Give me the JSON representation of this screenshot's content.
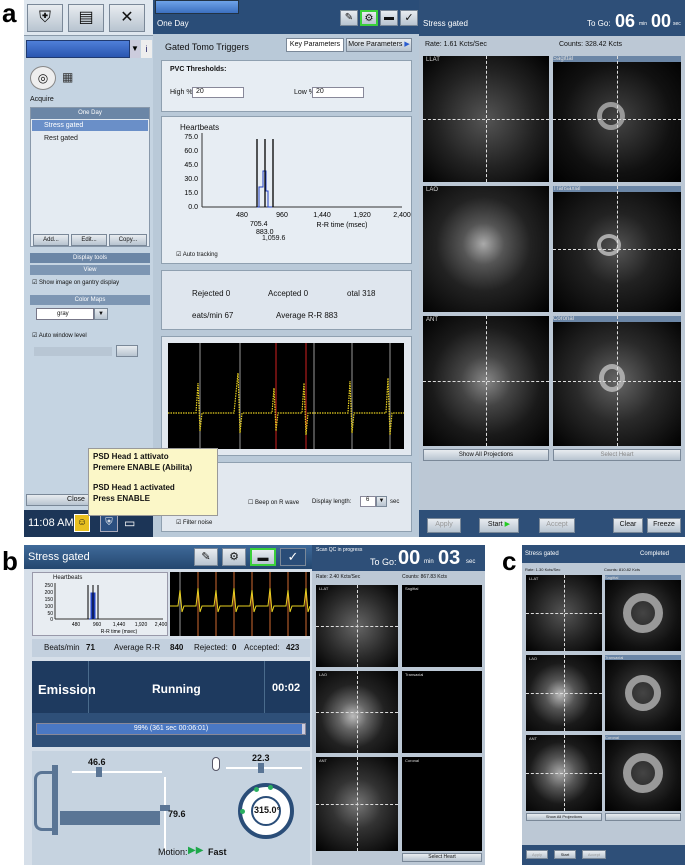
{
  "panels": {
    "a": "a",
    "b": "b",
    "c": "c"
  },
  "a": {
    "toolbar_mode_label": "One Day",
    "side": {
      "acquire": "Acquire",
      "protocol_title": "One Day",
      "protocol_items": [
        "Stress gated",
        "Rest gated"
      ],
      "btn_add": "Add...",
      "btn_edit": "Edit...",
      "btn_copy": "Copy...",
      "display_tools": "Display tools",
      "view": "View",
      "show_image_label": "Show image on gantry display",
      "color_maps": "Color Maps",
      "color_map_value": "gray",
      "auto_window": "Auto window level",
      "close": "Close",
      "clock": "11:08 AM"
    },
    "middle": {
      "title": "Gated Tomo Triggers",
      "tab_key": "Key Parameters",
      "tab_more": "More Parameters",
      "pvc_title": "PVC Thresholds:",
      "high_label": "High %",
      "high_value": "20",
      "low_label": "Low %",
      "low_value": "20",
      "hb_title": "Heartbeats",
      "y_ticks": [
        "75.0",
        "60.0",
        "45.0",
        "30.0",
        "15.0",
        "0.0"
      ],
      "x_ticks": [
        "480",
        "960",
        "1,440",
        "1,920",
        "2,400"
      ],
      "x_label": "R-R time (msec)",
      "markers": [
        "705.4",
        "883.0",
        "1,059.6"
      ],
      "auto_tracking": "Auto tracking",
      "rejected": "Rejected 0",
      "accepted": "Accepted 0",
      "total": "otal 318",
      "beats_min": "eats/min 67",
      "average_rr": "Average R-R 883",
      "beep": "Beep on R wave",
      "display_length": "Display length:",
      "display_length_value": "6",
      "sec": "sec",
      "filter": "Filter noise"
    },
    "tooltip": {
      "line1": "PSD Head 1 attivato",
      "line2": "Premere ENABLE (Abilita)",
      "line3": "PSD Head 1 activated",
      "line4": "Press ENABLE"
    },
    "right": {
      "title": "Stress gated",
      "to_go": "To Go:",
      "min_value": "06",
      "min_unit": "min",
      "sec_value": "00",
      "sec_unit": "sec",
      "rate": "Rate: 1.61 Kcts/Sec",
      "counts": "Counts: 328.42 Kcts",
      "scan_labels": [
        "LLAT",
        "Sagittal",
        "LAO",
        "Transaxial",
        "ANT",
        "Coronal"
      ],
      "show_all": "Show All Projections",
      "select_heart": "Select Heart",
      "apply": "Apply",
      "start": "Start",
      "accept": "Accept",
      "clear": "Clear",
      "freeze": "Freeze"
    }
  },
  "b": {
    "title": "Stress gated",
    "to_go": "To Go:",
    "min_value": "00",
    "min_unit": "min",
    "sec_value": "03",
    "sec_unit": "sec",
    "scan_qc": "Scan QC in progress",
    "hb_title": "Heartbeats",
    "y_ticks": [
      "250",
      "200",
      "150",
      "100",
      "50",
      "0"
    ],
    "x_ticks": [
      "480",
      "960",
      "1,440",
      "1,920",
      "2,400"
    ],
    "x_label": "R-R time (msec)",
    "beats_min_label": "Beats/min",
    "beats_min": "71",
    "avg_label": "Average R-R",
    "avg_value": "840",
    "rej_label": "Rejected:",
    "rej_value": "0",
    "acc_label": "Accepted:",
    "acc_value": "423",
    "emission": "Emission",
    "running": "Running",
    "elapsed": "00:02",
    "progress_text": "99% (361 sec  00:06:01)",
    "progress": 0.99,
    "gantry_top": "46.6",
    "gantry_side": "79.6",
    "detector_top": "22.3",
    "angle": "315.0°",
    "motion_label": "Motion:",
    "motion_value": "Fast",
    "rate": "Rate: 2.40 Kcts/Sec",
    "counts": "Counts: 867.83 Kcts",
    "scan_labels": [
      "LLAT",
      "Sagittal",
      "LAO",
      "Transaxial",
      "ANT",
      "Coronal"
    ],
    "select_heart": "Select Heart"
  },
  "c": {
    "title": "Stress gated",
    "status": "Completed",
    "rate": "Rate: 1.30 Kcts/Sec",
    "counts": "Counts: 810.82 Kcts",
    "scan_labels": [
      "LLAT",
      "Sagittal",
      "LAO",
      "Transaxial",
      "ANT",
      "Coronal"
    ],
    "show_all": "Show All Projections",
    "apply": "Apply",
    "start": "Start",
    "accept": "Accept"
  }
}
